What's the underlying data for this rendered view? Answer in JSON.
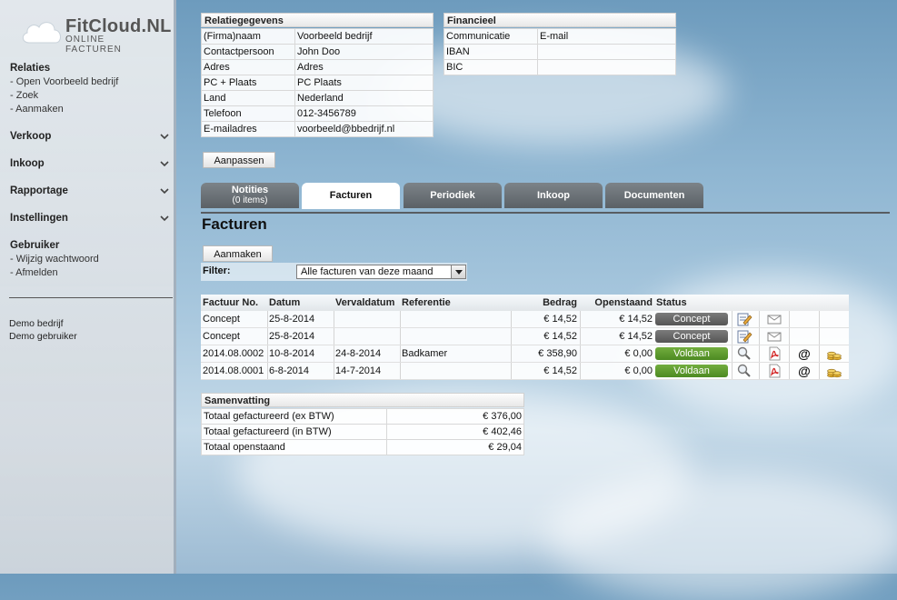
{
  "brand": {
    "title": "FitCloud.NL",
    "subtitle": "ONLINE FACTUREN"
  },
  "sidebar": {
    "relaties": {
      "label": "Relaties",
      "links": [
        "- Open Voorbeeld bedrijf",
        "- Zoek",
        "- Aanmaken"
      ]
    },
    "menus": [
      "Verkoop",
      "Inkoop",
      "Rapportage",
      "Instellingen"
    ],
    "gebruiker": {
      "label": "Gebruiker",
      "links": [
        "- Wijzig wachtwoord",
        "- Afmelden"
      ]
    },
    "footer": {
      "company": "Demo bedrijf",
      "user": "Demo gebruiker"
    }
  },
  "relatie": {
    "title": "Relatiegegevens",
    "rows": [
      {
        "label": "(Firma)naam",
        "value": "Voorbeeld bedrijf"
      },
      {
        "label": "Contactpersoon",
        "value": "John Doo"
      },
      {
        "label": "Adres",
        "value": "Adres"
      },
      {
        "label": "PC + Plaats",
        "value": "PC  Plaats"
      },
      {
        "label": "Land",
        "value": "Nederland"
      },
      {
        "label": "Telefoon",
        "value": "012-3456789"
      },
      {
        "label": "E-mailadres",
        "value": "voorbeeld@bbedrijf.nl"
      }
    ],
    "edit_button": "Aanpassen"
  },
  "financieel": {
    "title": "Financieel",
    "rows": [
      {
        "label": "Communicatie",
        "value": "E-mail"
      },
      {
        "label": "IBAN",
        "value": ""
      },
      {
        "label": "BIC",
        "value": ""
      }
    ]
  },
  "tabs": [
    {
      "label": "Notities",
      "sub": "(0 items)"
    },
    {
      "label": "Facturen",
      "sub": ""
    },
    {
      "label": "Periodiek",
      "sub": ""
    },
    {
      "label": "Inkoop",
      "sub": ""
    },
    {
      "label": "Documenten",
      "sub": ""
    }
  ],
  "active_tab": "Facturen",
  "facturen": {
    "title": "Facturen",
    "create_button": "Aanmaken",
    "filter_label": "Filter:",
    "filter_value": "Alle facturen van deze maand",
    "columns": [
      "Factuur No.",
      "Datum",
      "Vervaldatum",
      "Referentie",
      "Bedrag",
      "Openstaand",
      "Status"
    ],
    "rows": [
      {
        "no": "Concept",
        "datum": "25-8-2014",
        "verval": "",
        "ref": "",
        "bedrag": "€ 14,52",
        "open": "€ 14,52",
        "status": "Concept"
      },
      {
        "no": "Concept",
        "datum": "25-8-2014",
        "verval": "",
        "ref": "",
        "bedrag": "€ 14,52",
        "open": "€ 14,52",
        "status": "Concept"
      },
      {
        "no": "2014.08.0002",
        "datum": "10-8-2014",
        "verval": "24-8-2014",
        "ref": "Badkamer",
        "bedrag": "€ 358,90",
        "open": "€ 0,00",
        "status": "Voldaan"
      },
      {
        "no": "2014.08.0001",
        "datum": "6-8-2014",
        "verval": "14-7-2014",
        "ref": "",
        "bedrag": "€ 14,52",
        "open": "€ 0,00",
        "status": "Voldaan"
      }
    ]
  },
  "samenvatting": {
    "title": "Samenvatting",
    "rows": [
      {
        "label": "Totaal gefactureerd (ex BTW)",
        "value": "€ 376,00"
      },
      {
        "label": "Totaal gefactureerd (in BTW)",
        "value": "€ 402,46"
      },
      {
        "label": "Totaal openstaand",
        "value": "€ 29,04"
      }
    ]
  },
  "colors": {
    "concept": "#5f5f5f",
    "voldaan": "#5b9a2c",
    "tab": "#666c71"
  }
}
